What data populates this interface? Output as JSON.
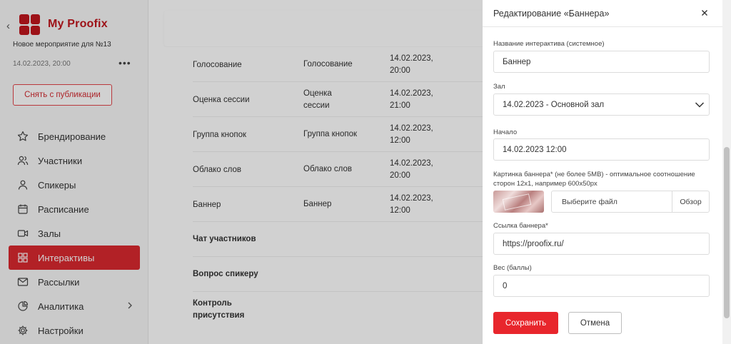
{
  "app": {
    "brand": "My Proofix"
  },
  "event": {
    "name": "Новое мероприятие для №13",
    "date": "14.02.2023, 20:00",
    "more": "•••"
  },
  "sidebar": {
    "unpublish_label": "Снять с публикации",
    "items": [
      {
        "label": "Брендирование",
        "icon": "star-icon"
      },
      {
        "label": "Участники",
        "icon": "users-icon"
      },
      {
        "label": "Спикеры",
        "icon": "user-icon"
      },
      {
        "label": "Расписание",
        "icon": "calendar-icon"
      },
      {
        "label": "Залы",
        "icon": "video-icon"
      },
      {
        "label": "Интерактивы",
        "icon": "grid-icon",
        "active": true
      },
      {
        "label": "Рассылки",
        "icon": "mail-icon"
      },
      {
        "label": "Аналитика",
        "icon": "chart-icon"
      },
      {
        "label": "Настройки",
        "icon": "gear-icon"
      }
    ]
  },
  "table": {
    "rows": [
      {
        "name": "Голосование",
        "type": "Голосование",
        "date": "14.02.2023,",
        "time": "20:00"
      },
      {
        "name": "Оценка сессии",
        "type": "Оценка",
        "type2": "сессии",
        "date": "14.02.2023,",
        "time": "21:00"
      },
      {
        "name": "Группа кнопок",
        "type": "Группа кнопок",
        "date": "14.02.2023,",
        "time": "12:00"
      },
      {
        "name": "Облако слов",
        "type": "Облако слов",
        "date": "14.02.2023,",
        "time": "20:00"
      },
      {
        "name": "Баннер",
        "type": "Баннер",
        "date": "14.02.2023,",
        "time": "12:00"
      },
      {
        "name": "Чат участников"
      },
      {
        "name": "Вопрос спикеру"
      },
      {
        "name": "Контроль",
        "name2": "присутствия"
      }
    ]
  },
  "drawer": {
    "title": "Редактирование «Баннера»",
    "fields": {
      "name_label": "Название интерактива (системное)",
      "name_value": "Баннер",
      "hall_label": "Зал",
      "hall_value": "14.02.2023 - Основной зал",
      "start_label": "Начало",
      "start_value": "14.02.2023 12:00",
      "image_label_1": "Картинка баннера* (не более 5MB) - оптимальное соотношение",
      "image_label_2": "сторон 12x1, например 600x50px",
      "file_placeholder": "Выберите файл",
      "browse_label": "Обзор",
      "link_label": "Ссылка баннера*",
      "link_value": "https://proofix.ru/",
      "weight_label": "Вес (баллы)",
      "weight_value": "0"
    },
    "save_label": "Сохранить",
    "cancel_label": "Отмена"
  },
  "colors": {
    "accent": "#e8262c",
    "brand": "#c0171e",
    "overlay": "rgba(0,0,0,0.18)"
  }
}
